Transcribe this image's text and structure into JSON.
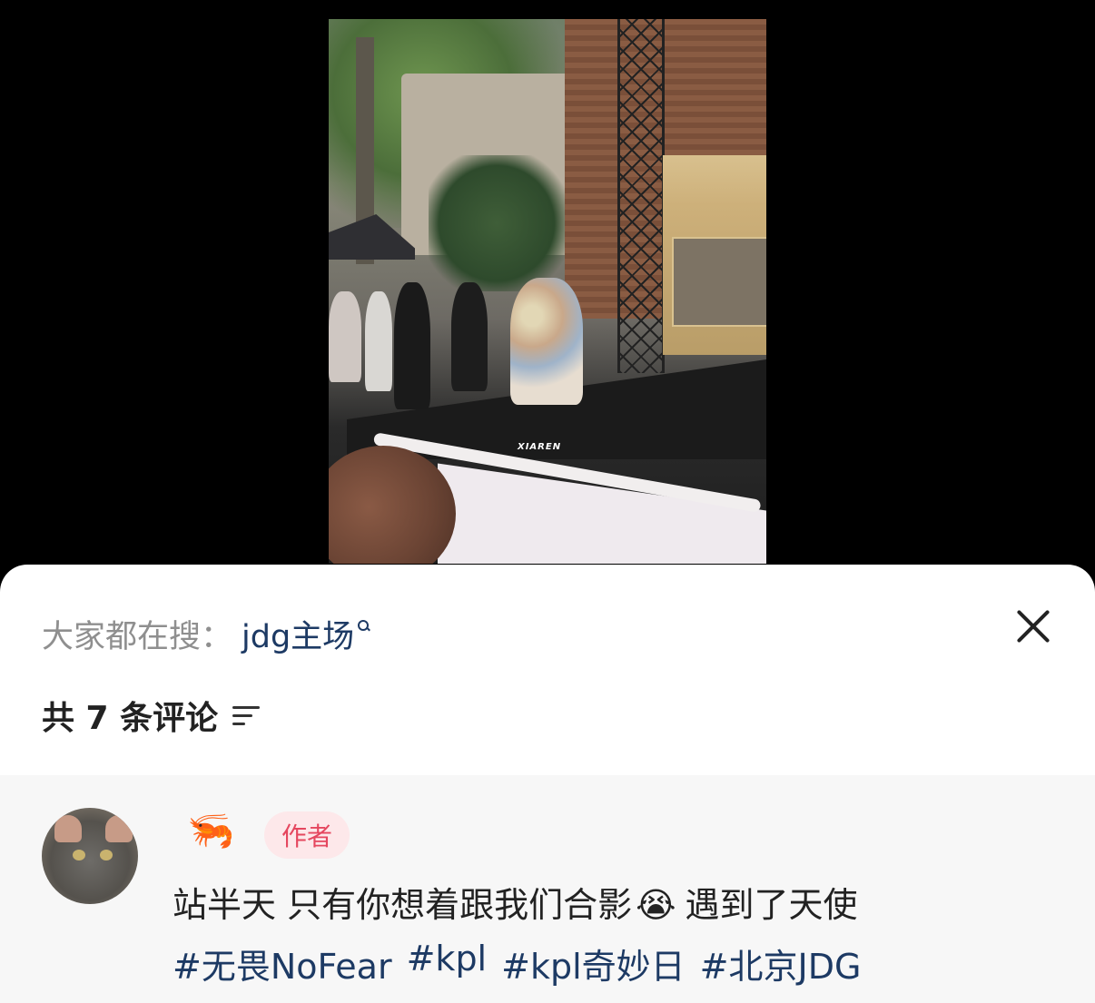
{
  "video": {
    "watermark": "XIAREN"
  },
  "search": {
    "prefix": "大家都在搜：",
    "term": "jdg主场"
  },
  "comments_header": {
    "count_label": "共 7 条评论"
  },
  "comment": {
    "username_emoji": "🦐",
    "author_badge": "作者",
    "text_before": "站半天 只有你想着跟我们合影",
    "emoji": "😭",
    "text_after": "遇到了天使",
    "tags": [
      "#无畏NoFear",
      "#kpl",
      "#kpl奇妙日",
      "#北京JDG"
    ]
  },
  "colors": {
    "link": "#1d3a64",
    "badge_text": "#e5475f",
    "badge_bg": "#fde8ea",
    "muted": "#8f8f8f"
  }
}
